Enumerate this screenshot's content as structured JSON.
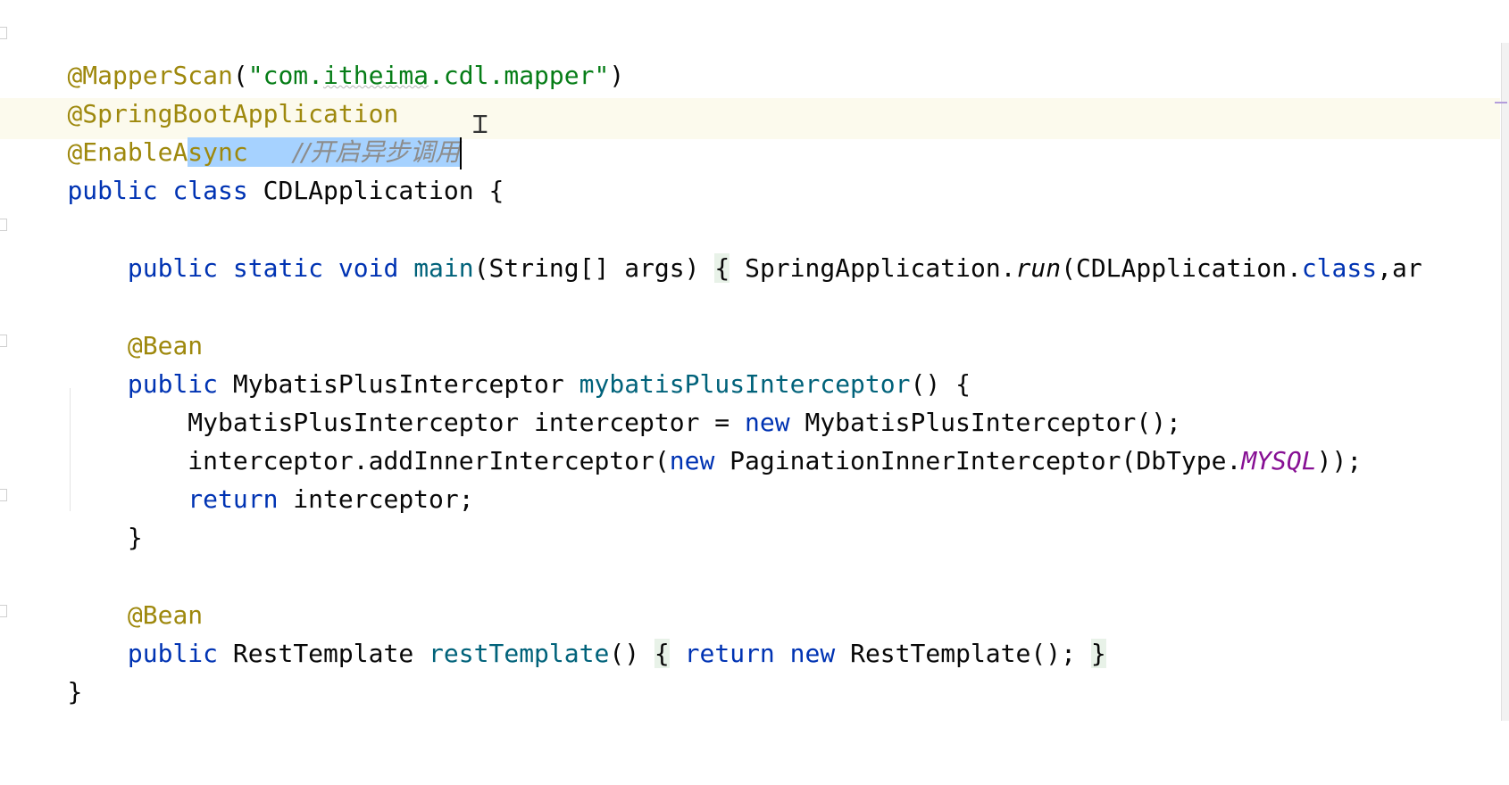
{
  "editor": {
    "line1": {
      "annotation": "@MapperScan",
      "open": "(",
      "string_open": "\"com.",
      "string_word": "itheima",
      "string_close": ".cdl.mapper\"",
      "close": ")"
    },
    "line2": {
      "annotation": "@SpringBootApplication"
    },
    "line3": {
      "annotation_part1": "@EnableA",
      "annotation_part2": "sync",
      "spacer": "   ",
      "comment": "//开启异步调用"
    },
    "line4": {
      "kw1": "public",
      "kw2": "class",
      "name": "CDLApplication",
      "brace": "{"
    },
    "line5": {
      "indent": "    ",
      "kw1": "public",
      "kw2": "static",
      "kw3": "void",
      "method": "main",
      "params": "(String[] args)",
      "brace_open": "{",
      "call_prefix": "SpringApplication.",
      "call_method": "run",
      "call_args_start": "(CDLApplication.",
      "class_kw": "class",
      "call_rest": ",ar"
    },
    "line6": {
      "indent": "    ",
      "annotation": "@Bean"
    },
    "line7": {
      "indent": "    ",
      "kw": "public",
      "type": "MybatisPlusInterceptor",
      "method": "mybatisPlusInterceptor",
      "rest": "() {"
    },
    "line8": {
      "indent": "        ",
      "text1": "MybatisPlusInterceptor interceptor = ",
      "kw": "new",
      "text2": " MybatisPlusInterceptor();"
    },
    "line9": {
      "indent": "        ",
      "text1": "interceptor.addInnerInterceptor(",
      "kw": "new",
      "text2": " PaginationInnerInterceptor(DbType.",
      "const": "MYSQL",
      "text3": "));"
    },
    "line10": {
      "indent": "        ",
      "kw": "return",
      "text": " interceptor;"
    },
    "line11": {
      "indent": "    ",
      "brace": "}"
    },
    "line12": {
      "indent": "    ",
      "annotation": "@Bean"
    },
    "line13": {
      "indent": "    ",
      "kw": "public",
      "type": " RestTemplate ",
      "method": "restTemplate",
      "parens": "() ",
      "brace_open": "{",
      "kw_return": "return",
      "kw_new": "new",
      "text": " RestTemplate(); ",
      "brace_close": "}"
    },
    "line14": {
      "brace": "}"
    },
    "cursor_icon": "text-cursor-ibeam"
  }
}
